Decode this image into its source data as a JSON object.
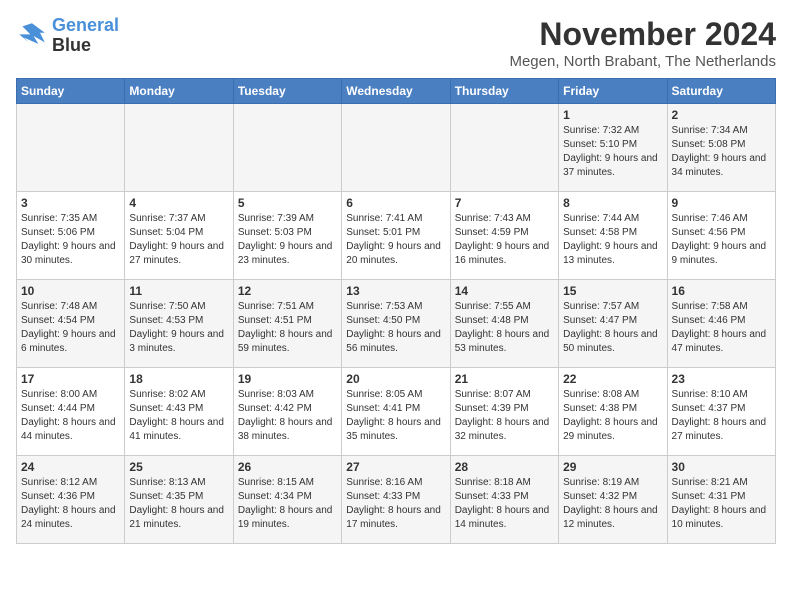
{
  "header": {
    "logo_line1": "General",
    "logo_line2": "Blue",
    "month": "November 2024",
    "location": "Megen, North Brabant, The Netherlands"
  },
  "weekdays": [
    "Sunday",
    "Monday",
    "Tuesday",
    "Wednesday",
    "Thursday",
    "Friday",
    "Saturday"
  ],
  "weeks": [
    [
      {
        "day": "",
        "info": ""
      },
      {
        "day": "",
        "info": ""
      },
      {
        "day": "",
        "info": ""
      },
      {
        "day": "",
        "info": ""
      },
      {
        "day": "",
        "info": ""
      },
      {
        "day": "1",
        "info": "Sunrise: 7:32 AM\nSunset: 5:10 PM\nDaylight: 9 hours and 37 minutes."
      },
      {
        "day": "2",
        "info": "Sunrise: 7:34 AM\nSunset: 5:08 PM\nDaylight: 9 hours and 34 minutes."
      }
    ],
    [
      {
        "day": "3",
        "info": "Sunrise: 7:35 AM\nSunset: 5:06 PM\nDaylight: 9 hours and 30 minutes."
      },
      {
        "day": "4",
        "info": "Sunrise: 7:37 AM\nSunset: 5:04 PM\nDaylight: 9 hours and 27 minutes."
      },
      {
        "day": "5",
        "info": "Sunrise: 7:39 AM\nSunset: 5:03 PM\nDaylight: 9 hours and 23 minutes."
      },
      {
        "day": "6",
        "info": "Sunrise: 7:41 AM\nSunset: 5:01 PM\nDaylight: 9 hours and 20 minutes."
      },
      {
        "day": "7",
        "info": "Sunrise: 7:43 AM\nSunset: 4:59 PM\nDaylight: 9 hours and 16 minutes."
      },
      {
        "day": "8",
        "info": "Sunrise: 7:44 AM\nSunset: 4:58 PM\nDaylight: 9 hours and 13 minutes."
      },
      {
        "day": "9",
        "info": "Sunrise: 7:46 AM\nSunset: 4:56 PM\nDaylight: 9 hours and 9 minutes."
      }
    ],
    [
      {
        "day": "10",
        "info": "Sunrise: 7:48 AM\nSunset: 4:54 PM\nDaylight: 9 hours and 6 minutes."
      },
      {
        "day": "11",
        "info": "Sunrise: 7:50 AM\nSunset: 4:53 PM\nDaylight: 9 hours and 3 minutes."
      },
      {
        "day": "12",
        "info": "Sunrise: 7:51 AM\nSunset: 4:51 PM\nDaylight: 8 hours and 59 minutes."
      },
      {
        "day": "13",
        "info": "Sunrise: 7:53 AM\nSunset: 4:50 PM\nDaylight: 8 hours and 56 minutes."
      },
      {
        "day": "14",
        "info": "Sunrise: 7:55 AM\nSunset: 4:48 PM\nDaylight: 8 hours and 53 minutes."
      },
      {
        "day": "15",
        "info": "Sunrise: 7:57 AM\nSunset: 4:47 PM\nDaylight: 8 hours and 50 minutes."
      },
      {
        "day": "16",
        "info": "Sunrise: 7:58 AM\nSunset: 4:46 PM\nDaylight: 8 hours and 47 minutes."
      }
    ],
    [
      {
        "day": "17",
        "info": "Sunrise: 8:00 AM\nSunset: 4:44 PM\nDaylight: 8 hours and 44 minutes."
      },
      {
        "day": "18",
        "info": "Sunrise: 8:02 AM\nSunset: 4:43 PM\nDaylight: 8 hours and 41 minutes."
      },
      {
        "day": "19",
        "info": "Sunrise: 8:03 AM\nSunset: 4:42 PM\nDaylight: 8 hours and 38 minutes."
      },
      {
        "day": "20",
        "info": "Sunrise: 8:05 AM\nSunset: 4:41 PM\nDaylight: 8 hours and 35 minutes."
      },
      {
        "day": "21",
        "info": "Sunrise: 8:07 AM\nSunset: 4:39 PM\nDaylight: 8 hours and 32 minutes."
      },
      {
        "day": "22",
        "info": "Sunrise: 8:08 AM\nSunset: 4:38 PM\nDaylight: 8 hours and 29 minutes."
      },
      {
        "day": "23",
        "info": "Sunrise: 8:10 AM\nSunset: 4:37 PM\nDaylight: 8 hours and 27 minutes."
      }
    ],
    [
      {
        "day": "24",
        "info": "Sunrise: 8:12 AM\nSunset: 4:36 PM\nDaylight: 8 hours and 24 minutes."
      },
      {
        "day": "25",
        "info": "Sunrise: 8:13 AM\nSunset: 4:35 PM\nDaylight: 8 hours and 21 minutes."
      },
      {
        "day": "26",
        "info": "Sunrise: 8:15 AM\nSunset: 4:34 PM\nDaylight: 8 hours and 19 minutes."
      },
      {
        "day": "27",
        "info": "Sunrise: 8:16 AM\nSunset: 4:33 PM\nDaylight: 8 hours and 17 minutes."
      },
      {
        "day": "28",
        "info": "Sunrise: 8:18 AM\nSunset: 4:33 PM\nDaylight: 8 hours and 14 minutes."
      },
      {
        "day": "29",
        "info": "Sunrise: 8:19 AM\nSunset: 4:32 PM\nDaylight: 8 hours and 12 minutes."
      },
      {
        "day": "30",
        "info": "Sunrise: 8:21 AM\nSunset: 4:31 PM\nDaylight: 8 hours and 10 minutes."
      }
    ]
  ]
}
